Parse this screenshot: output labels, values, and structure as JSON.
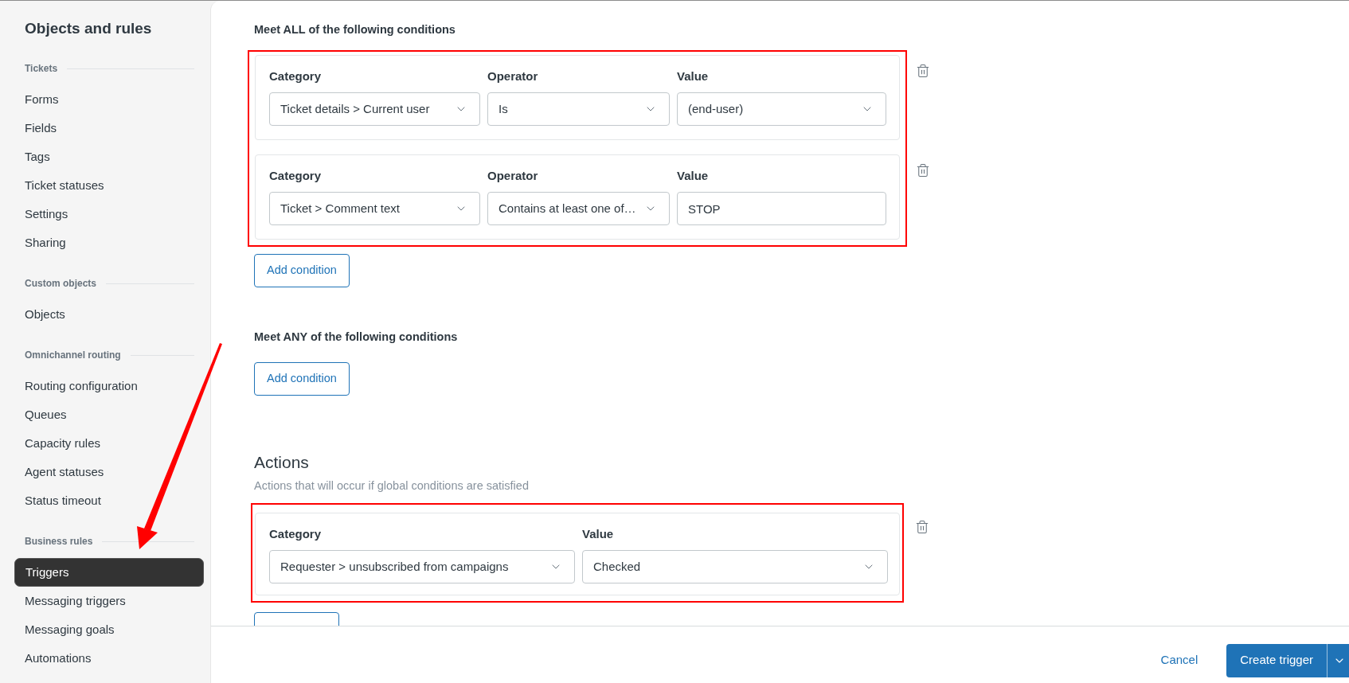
{
  "sidebar": {
    "title": "Objects and rules",
    "sections": [
      {
        "heading": "Tickets",
        "items": [
          {
            "label": "Forms",
            "selected": false
          },
          {
            "label": "Fields",
            "selected": false
          },
          {
            "label": "Tags",
            "selected": false
          },
          {
            "label": "Ticket statuses",
            "selected": false
          },
          {
            "label": "Settings",
            "selected": false
          },
          {
            "label": "Sharing",
            "selected": false
          }
        ]
      },
      {
        "heading": "Custom objects",
        "items": [
          {
            "label": "Objects",
            "selected": false
          }
        ]
      },
      {
        "heading": "Omnichannel routing",
        "items": [
          {
            "label": "Routing configuration",
            "selected": false
          },
          {
            "label": "Queues",
            "selected": false
          },
          {
            "label": "Capacity rules",
            "selected": false
          },
          {
            "label": "Agent statuses",
            "selected": false
          },
          {
            "label": "Status timeout",
            "selected": false
          }
        ]
      },
      {
        "heading": "Business rules",
        "items": [
          {
            "label": "Triggers",
            "selected": true
          },
          {
            "label": "Messaging triggers",
            "selected": false
          },
          {
            "label": "Messaging goals",
            "selected": false
          },
          {
            "label": "Automations",
            "selected": false
          }
        ]
      }
    ]
  },
  "conditions_all": {
    "heading": "Meet ALL of the following conditions",
    "highlighted": true,
    "rows": [
      {
        "fields": [
          {
            "label": "Category",
            "kind": "select",
            "value": "Ticket details > Current user"
          },
          {
            "label": "Operator",
            "kind": "select",
            "value": "Is"
          },
          {
            "label": "Value",
            "kind": "select",
            "value": "(end-user)"
          }
        ]
      },
      {
        "fields": [
          {
            "label": "Category",
            "kind": "select",
            "value": "Ticket > Comment text"
          },
          {
            "label": "Operator",
            "kind": "select",
            "value": "Contains at least one of…"
          },
          {
            "label": "Value",
            "kind": "text",
            "value": "STOP"
          }
        ]
      }
    ],
    "add_button": "Add condition"
  },
  "conditions_any": {
    "heading": "Meet ANY of the following conditions",
    "add_button": "Add condition"
  },
  "actions": {
    "title": "Actions",
    "subtitle": "Actions that will occur if global conditions are satisfied",
    "highlighted": true,
    "rows": [
      {
        "fields": [
          {
            "label": "Category",
            "kind": "select",
            "value": "Requester > unsubscribed from campaigns"
          },
          {
            "label": "Value",
            "kind": "select",
            "value": "Checked"
          }
        ]
      }
    ]
  },
  "footer": {
    "cancel": "Cancel",
    "submit": "Create trigger"
  },
  "annotations": [
    {
      "kind": "arrow"
    }
  ]
}
